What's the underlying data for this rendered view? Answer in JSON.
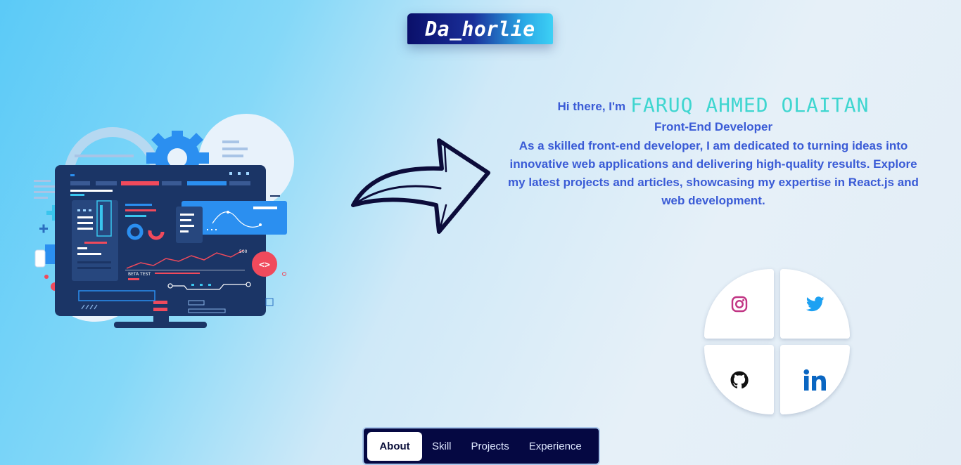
{
  "logo": {
    "text": "Da_horlie"
  },
  "intro": {
    "greeting": "Hi there, I'm",
    "name": "FARUQ AHMED OLAITAN",
    "role": "Front-End Developer",
    "bio": "As a skilled front-end developer, I am dedicated to turning ideas into innovative web applications and delivering high-quality results. Explore my latest projects and articles, showcasing my expertise in React.js and web development."
  },
  "illustration": {
    "marker_value": "500",
    "beta_label": "BETA TEST",
    "code_badge": "<>"
  },
  "social": [
    {
      "name": "instagram",
      "icon": "instagram-icon",
      "color": "#c13584"
    },
    {
      "name": "twitter",
      "icon": "twitter-icon",
      "color": "#1da1f2"
    },
    {
      "name": "github",
      "icon": "github-icon",
      "color": "#111111"
    },
    {
      "name": "linkedin",
      "icon": "linkedin-icon",
      "color": "#0a66c2"
    }
  ],
  "nav": {
    "items": [
      "About",
      "Skill",
      "Projects",
      "Experience"
    ],
    "active": "About"
  },
  "colors": {
    "accent_text": "#3a5bd6",
    "name_color": "#3fd6d0",
    "nav_bg": "#050842"
  }
}
